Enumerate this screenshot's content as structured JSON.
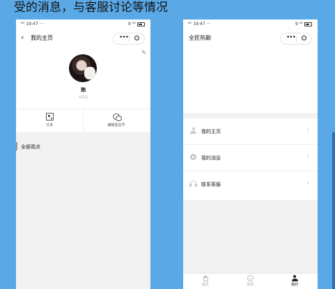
{
  "slide": {
    "title_text": "受的消息，与客服讨论等情况"
  },
  "left_phone": {
    "status": {
      "left": "⁴ᴳ 19:47 ···",
      "right": "9 ⁴ᴳ"
    },
    "nav": {
      "back_glyph": "‹",
      "title": "我的主页"
    },
    "profile": {
      "name": "她",
      "subline": "0关注"
    },
    "actions": [
      {
        "label": "分享",
        "icon": "qr-code-icon"
      },
      {
        "label": "编辑签信号",
        "icon": "chat-bubbles-icon"
      }
    ],
    "section": {
      "label": "全部观点"
    }
  },
  "right_phone": {
    "status": {
      "left": "⁴ᴳ 19:47 ···",
      "right": "9 ⁴ᴳ"
    },
    "nav": {
      "title": "全民热聊"
    },
    "menu": [
      {
        "label": "我的主页",
        "icon": "person-icon"
      },
      {
        "label": "我的消息",
        "icon": "message-icon"
      },
      {
        "label": "联系客服",
        "icon": "headset-icon"
      }
    ],
    "tabbar": [
      {
        "label": "首页",
        "icon": "home-icon",
        "active": false
      },
      {
        "label": "发现",
        "icon": "discover-icon",
        "active": false
      },
      {
        "label": "我的",
        "icon": "mine-icon",
        "active": true
      }
    ]
  },
  "colors": {
    "slide_bg": "#5aa9e6",
    "page_bg": "#f2f2f2",
    "accent_dark": "#222222"
  }
}
